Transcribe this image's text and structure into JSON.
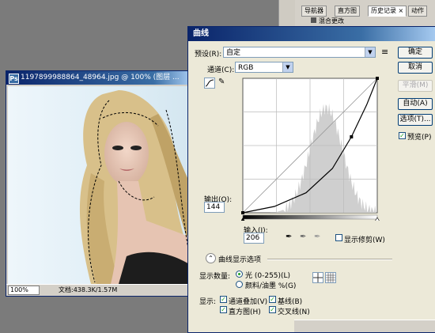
{
  "history_panel": {
    "tabs": [
      "导航器",
      "直方图",
      "历史记录",
      "动作"
    ],
    "active_tab": "历史记录",
    "close_glyph": "×",
    "visible_step": "混合更改"
  },
  "document": {
    "title": "1197899988864_48964.jpg @ 100% (图层 ...",
    "zoom": "100%",
    "doc_size": "文档:438.3K/1.57M"
  },
  "curves_dialog": {
    "title": "曲线",
    "preset_label": "预设(R):",
    "preset_value": "自定",
    "channel_label": "通道(C):",
    "channel_value": "RGB",
    "output_label": "输出(O):",
    "output_value": "144",
    "input_label": "输入(I):",
    "input_value": "206",
    "show_clipping_label": "显示修剪(W)",
    "curve_display_options_label": "曲线显示选项",
    "show_amount_label": "显示数量:",
    "light_option": "光 (0-255)(L)",
    "pigment_option": "颜料/油墨 %(G)",
    "show_label": "显示:",
    "channel_overlays": "通道叠加(V)",
    "baseline": "基线(B)",
    "histogram": "直方图(H)",
    "intersection_line": "交叉线(N)",
    "buttons": {
      "ok": "确定",
      "cancel": "取消",
      "smooth": "平滑(M)",
      "auto": "自动(A)",
      "options": "选项(T)..."
    },
    "preview_label": "预览(P)",
    "preset_menu_glyph": "≡",
    "collapse_glyph": "⌃"
  },
  "chart_data": {
    "type": "line",
    "description_of_axes": "input (0-255) vs output (0-255)",
    "xlim": [
      0,
      255
    ],
    "ylim": [
      0,
      255
    ],
    "grid": true,
    "series": [
      {
        "x": [
          0,
          60,
          120,
          170,
          206,
          235,
          255
        ],
        "y": [
          0,
          12,
          38,
          84,
          144,
          205,
          255
        ]
      }
    ],
    "control_points": [
      {
        "x": 0,
        "y": 0
      },
      {
        "x": 206,
        "y": 144
      },
      {
        "x": 255,
        "y": 255
      }
    ]
  },
  "colors": {
    "titlebar": "#0a246a",
    "dialog_bg": "#ece9d8",
    "checkbox_mark": "#21a121"
  }
}
